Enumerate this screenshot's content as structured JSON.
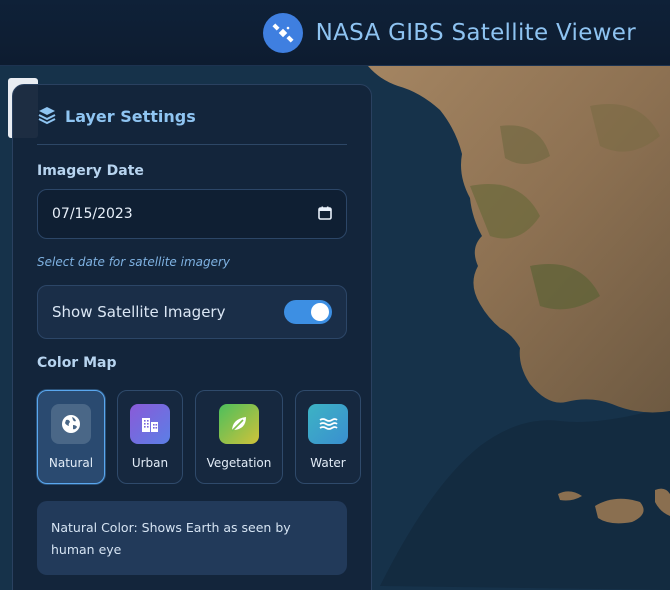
{
  "header": {
    "title": "NASA GIBS Satellite Viewer",
    "logo_icon": "satellite-icon",
    "accent": "#3f7fe0"
  },
  "panel": {
    "title": "Layer Settings",
    "title_icon": "layers-icon",
    "imagery_date": {
      "label": "Imagery Date",
      "value": "07/15/2023",
      "hint": "Select date for satellite imagery",
      "icon": "calendar-icon"
    },
    "imagery_toggle": {
      "label": "Show Satellite Imagery",
      "checked": true
    },
    "color_map": {
      "label": "Color Map",
      "options": [
        {
          "label": "Natural",
          "icon": "globe-icon",
          "active": true
        },
        {
          "label": "Urban",
          "icon": "buildings-icon",
          "active": false
        },
        {
          "label": "Vegetation",
          "icon": "leaf-icon",
          "active": false
        },
        {
          "label": "Water",
          "icon": "water-icon",
          "active": false
        }
      ],
      "description": "Natural Color: Shows Earth as seen by human eye"
    }
  }
}
